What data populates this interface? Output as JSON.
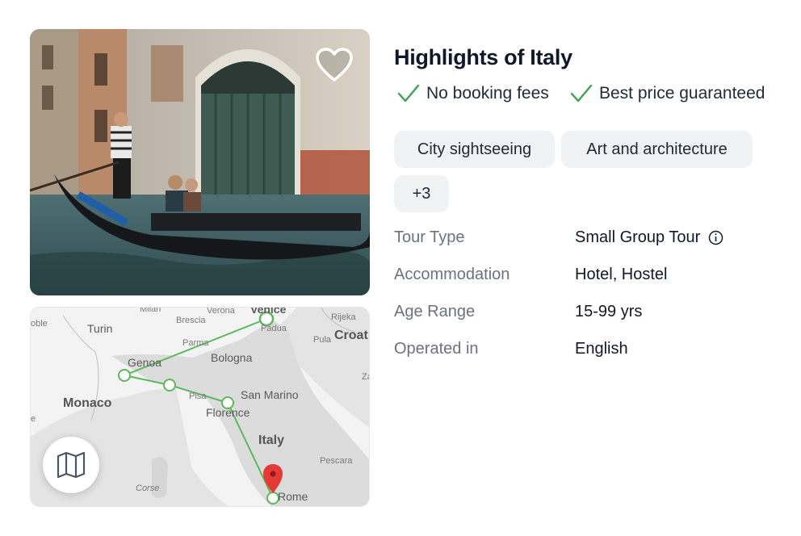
{
  "tour": {
    "title": "Highlights of Italy",
    "perks": [
      "No booking fees",
      "Best price guaranteed"
    ],
    "tags": [
      "City sightseeing",
      "Art and architecture",
      "+3"
    ],
    "favorite_icon": "heart-outline-icon",
    "check_color": "#3fa34d",
    "details": [
      {
        "label": "Tour Type",
        "value": "Small Group Tour",
        "icon": "info-circle-icon"
      },
      {
        "label": "Accommodation",
        "value": "Hotel, Hostel"
      },
      {
        "label": "Age Range",
        "value": "15-99 yrs"
      },
      {
        "label": "Operated in",
        "value": "English"
      }
    ]
  },
  "map": {
    "route_color": "#5cb85c",
    "pin_color": "#e53935",
    "toggle_icon": "map-icon",
    "labels": {
      "milan": "Milan",
      "verona": "Verona",
      "venice": "Venice",
      "brescia": "Brescia",
      "padua": "Padua",
      "rijeka": "Rijeka",
      "turin": "Turin",
      "pula": "Pula",
      "croatia": "Croat",
      "parma": "Parma",
      "bologna": "Bologna",
      "genoa": "Genoa",
      "monaco": "Monaco",
      "pisa": "Pisa",
      "san_marino": "San Marino",
      "florence": "Florence",
      "italy": "Italy",
      "pescara": "Pescara",
      "corse": "Corse",
      "rome": "Rome",
      "noble_frag": "oble",
      "e_frag": "e",
      "za_frag": "Za"
    }
  }
}
